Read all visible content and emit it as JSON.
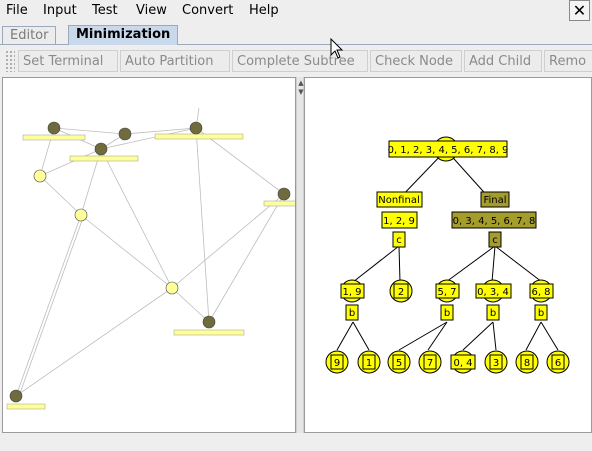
{
  "menu": {
    "file": "File",
    "input": "Input",
    "test": "Test",
    "view": "View",
    "convert": "Convert",
    "help": "Help"
  },
  "window": {
    "close_glyph": "✕"
  },
  "tabs": {
    "editor": "Editor",
    "minimization": "Minimization"
  },
  "toolbar": {
    "set_terminal": "Set Terminal",
    "auto_partition": "Auto Partition",
    "complete_subtree": "Complete Subtree",
    "check_node": "Check Node",
    "add_child": "Add Child",
    "remove": "Remo"
  },
  "divider": {
    "up": "▲",
    "down": "▼"
  },
  "tree": {
    "root": "0, 1, 2, 3, 4, 5, 6, 7, 8, 9",
    "nonfinal_label": "Nonfinal",
    "final_label": "Final",
    "nonfinal_set": "1, 2, 9",
    "final_set": "0, 3, 4, 5, 6, 7, 8",
    "symbol_c": "c",
    "symbol_b": "b",
    "n19": "1, 9",
    "n2": "2",
    "n57": "5, 7",
    "n034": "0, 3, 4",
    "n68": "6, 8",
    "l9": "9",
    "l1": "1",
    "l5": "5",
    "l7": "7",
    "l04": "0, 4",
    "l3": "3",
    "l8": "8",
    "l6": "6"
  },
  "colors": {
    "yellow": "#ffff00",
    "olive": "#a49d2c",
    "state_dark": "#6f6b3c",
    "state_light": "#ffff9a"
  }
}
